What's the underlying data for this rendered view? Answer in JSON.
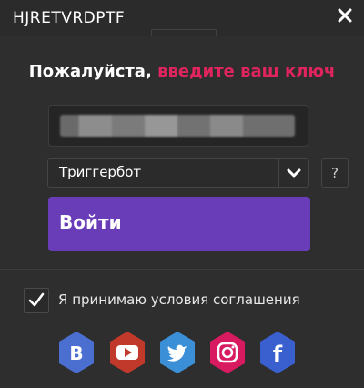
{
  "window": {
    "title": "HJRETVRDPTF",
    "close_icon": "close-icon"
  },
  "heading": {
    "white_text": "Пожалуйста,",
    "accent_text": "введите ваш ключ"
  },
  "key_input": {
    "value": "",
    "obscured": true
  },
  "mode_select": {
    "selected": "Триггербот",
    "icon": "chevron-down-icon"
  },
  "help_button": {
    "label": "?"
  },
  "login_button": {
    "label": "Войти"
  },
  "terms": {
    "checked": true,
    "label": "Я принимаю условия соглашения"
  },
  "social": [
    {
      "name": "vk",
      "letter": "B",
      "color": "#4a6fd1"
    },
    {
      "name": "youtube",
      "color": "#c0392b"
    },
    {
      "name": "twitter",
      "color": "#3a8fd6"
    },
    {
      "name": "instagram",
      "color": "#d81b60"
    },
    {
      "name": "facebook",
      "letter": "f",
      "color": "#3a5fcf"
    }
  ],
  "colors": {
    "accent": "#e0245e",
    "button": "#6a3db8",
    "background": "#2e2e2e"
  }
}
